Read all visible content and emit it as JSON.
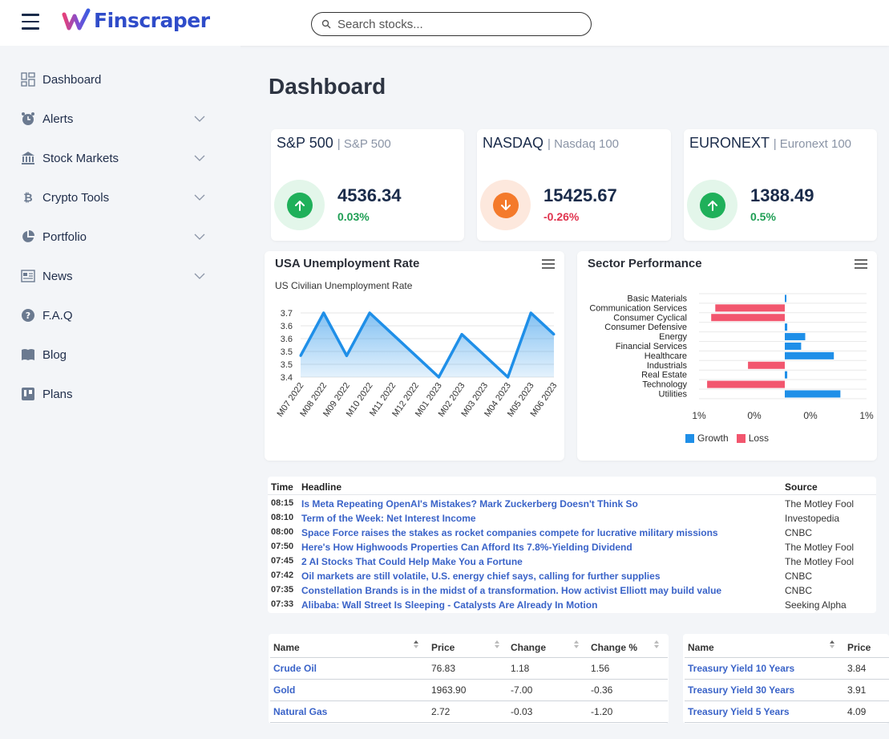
{
  "app": {
    "name": "Finscraper"
  },
  "search": {
    "placeholder": "Search stocks..."
  },
  "sidebar": {
    "items": [
      {
        "label": "Dashboard",
        "icon": "dashboard-icon"
      },
      {
        "label": "Alerts",
        "icon": "alarm-icon"
      },
      {
        "label": "Stock Markets",
        "icon": "bank-icon"
      },
      {
        "label": "Crypto Tools",
        "icon": "bitcoin-icon"
      },
      {
        "label": "Portfolio",
        "icon": "pie-icon"
      },
      {
        "label": "News",
        "icon": "newspaper-icon"
      },
      {
        "label": "F.A.Q",
        "icon": "question-icon"
      },
      {
        "label": "Blog",
        "icon": "book-icon"
      },
      {
        "label": "Plans",
        "icon": "plans-icon"
      }
    ]
  },
  "page": {
    "title": "Dashboard"
  },
  "indices": [
    {
      "name": "S&P 500",
      "sub": "| S&P 500",
      "value": "4536.34",
      "change": "0.03%",
      "direction": "up"
    },
    {
      "name": "NASDAQ",
      "sub": "| Nasdaq 100",
      "value": "15425.67",
      "change": "-0.26%",
      "direction": "down"
    },
    {
      "name": "EURONEXT",
      "sub": "| Euronext 100",
      "value": "1388.49",
      "change": "0.5%",
      "direction": "up"
    }
  ],
  "colors": {
    "up": "#1e9e54",
    "down": "#e0334e",
    "brand": "#2f4cc9",
    "link": "#3a63c8",
    "growth": "#1f8fe8",
    "loss": "#f2566e"
  },
  "unemployment": {
    "title": "USA Unemployment Rate",
    "subtitle": "US Civilian Unemployment Rate",
    "chart_data": {
      "type": "area",
      "categories": [
        "M07 2022",
        "M08 2022",
        "M09 2022",
        "M10 2022",
        "M11 2022",
        "M12 2022",
        "M01 2023",
        "M02 2023",
        "M03 2023",
        "M04 2023",
        "M05 2023",
        "M06 2023"
      ],
      "values": [
        3.5,
        3.7,
        3.5,
        3.7,
        3.6,
        3.5,
        3.4,
        3.6,
        3.5,
        3.4,
        3.7,
        3.6
      ],
      "yticks": [
        "3.7",
        "3.6",
        "3.6",
        "3.5",
        "3.5",
        "3.4"
      ],
      "ylim": [
        3.4,
        3.7
      ]
    }
  },
  "sector": {
    "title": "Sector Performance",
    "chart_data": {
      "type": "bar",
      "categories": [
        "Basic Materials",
        "Communication Services",
        "Consumer Cyclical",
        "Consumer Defensive",
        "Energy",
        "Financial Services",
        "Healthcare",
        "Industrials",
        "Real Estate",
        "Technology",
        "Utilities"
      ],
      "values": [
        0.02,
        -0.85,
        -0.9,
        0.03,
        0.25,
        0.2,
        0.6,
        -0.45,
        0.03,
        -0.95,
        0.68
      ],
      "xticks": [
        "1%",
        "0%",
        "0%",
        "1%"
      ],
      "xlim": [
        -1,
        1
      ],
      "legend": [
        "Growth",
        "Loss"
      ]
    }
  },
  "news": {
    "headers": {
      "time": "Time",
      "headline": "Headline",
      "source": "Source"
    },
    "rows": [
      {
        "time": "08:15",
        "headline": "Is Meta Repeating OpenAI's Mistakes? Mark Zuckerberg Doesn't Think So",
        "source": "The Motley Fool"
      },
      {
        "time": "08:10",
        "headline": "Term of the Week: Net Interest Income",
        "source": "Investopedia"
      },
      {
        "time": "08:00",
        "headline": "Space Force raises the stakes as rocket companies compete for lucrative military missions",
        "source": "CNBC"
      },
      {
        "time": "07:50",
        "headline": "Here's How Highwoods Properties Can Afford Its 7.8%-Yielding Dividend",
        "source": "The Motley Fool"
      },
      {
        "time": "07:45",
        "headline": "2 AI Stocks That Could Help Make You a Fortune",
        "source": "The Motley Fool"
      },
      {
        "time": "07:42",
        "headline": "Oil markets are still volatile, U.S. energy chief says, calling for further supplies",
        "source": "CNBC"
      },
      {
        "time": "07:35",
        "headline": "Constellation Brands is in the midst of a transformation. How activist Elliott may build value",
        "source": "CNBC"
      },
      {
        "time": "07:33",
        "headline": "Alibaba: Wall Street Is Sleeping - Catalysts Are Already In Motion",
        "source": "Seeking Alpha"
      }
    ]
  },
  "commodities": {
    "headers": {
      "name": "Name",
      "price": "Price",
      "change": "Change",
      "change_pct": "Change %"
    },
    "rows": [
      {
        "name": "Crude Oil",
        "price": "76.83",
        "change": "1.18",
        "change_pct": "1.56"
      },
      {
        "name": "Gold",
        "price": "1963.90",
        "change": "-7.00",
        "change_pct": "-0.36"
      },
      {
        "name": "Natural Gas",
        "price": "2.72",
        "change": "-0.03",
        "change_pct": "-1.20"
      }
    ]
  },
  "treasuries": {
    "headers": {
      "name": "Name",
      "price": "Price"
    },
    "rows": [
      {
        "name": "Treasury Yield 10 Years",
        "price": "3.84"
      },
      {
        "name": "Treasury Yield 30 Years",
        "price": "3.91"
      },
      {
        "name": "Treasury Yield 5 Years",
        "price": "4.09"
      }
    ]
  }
}
